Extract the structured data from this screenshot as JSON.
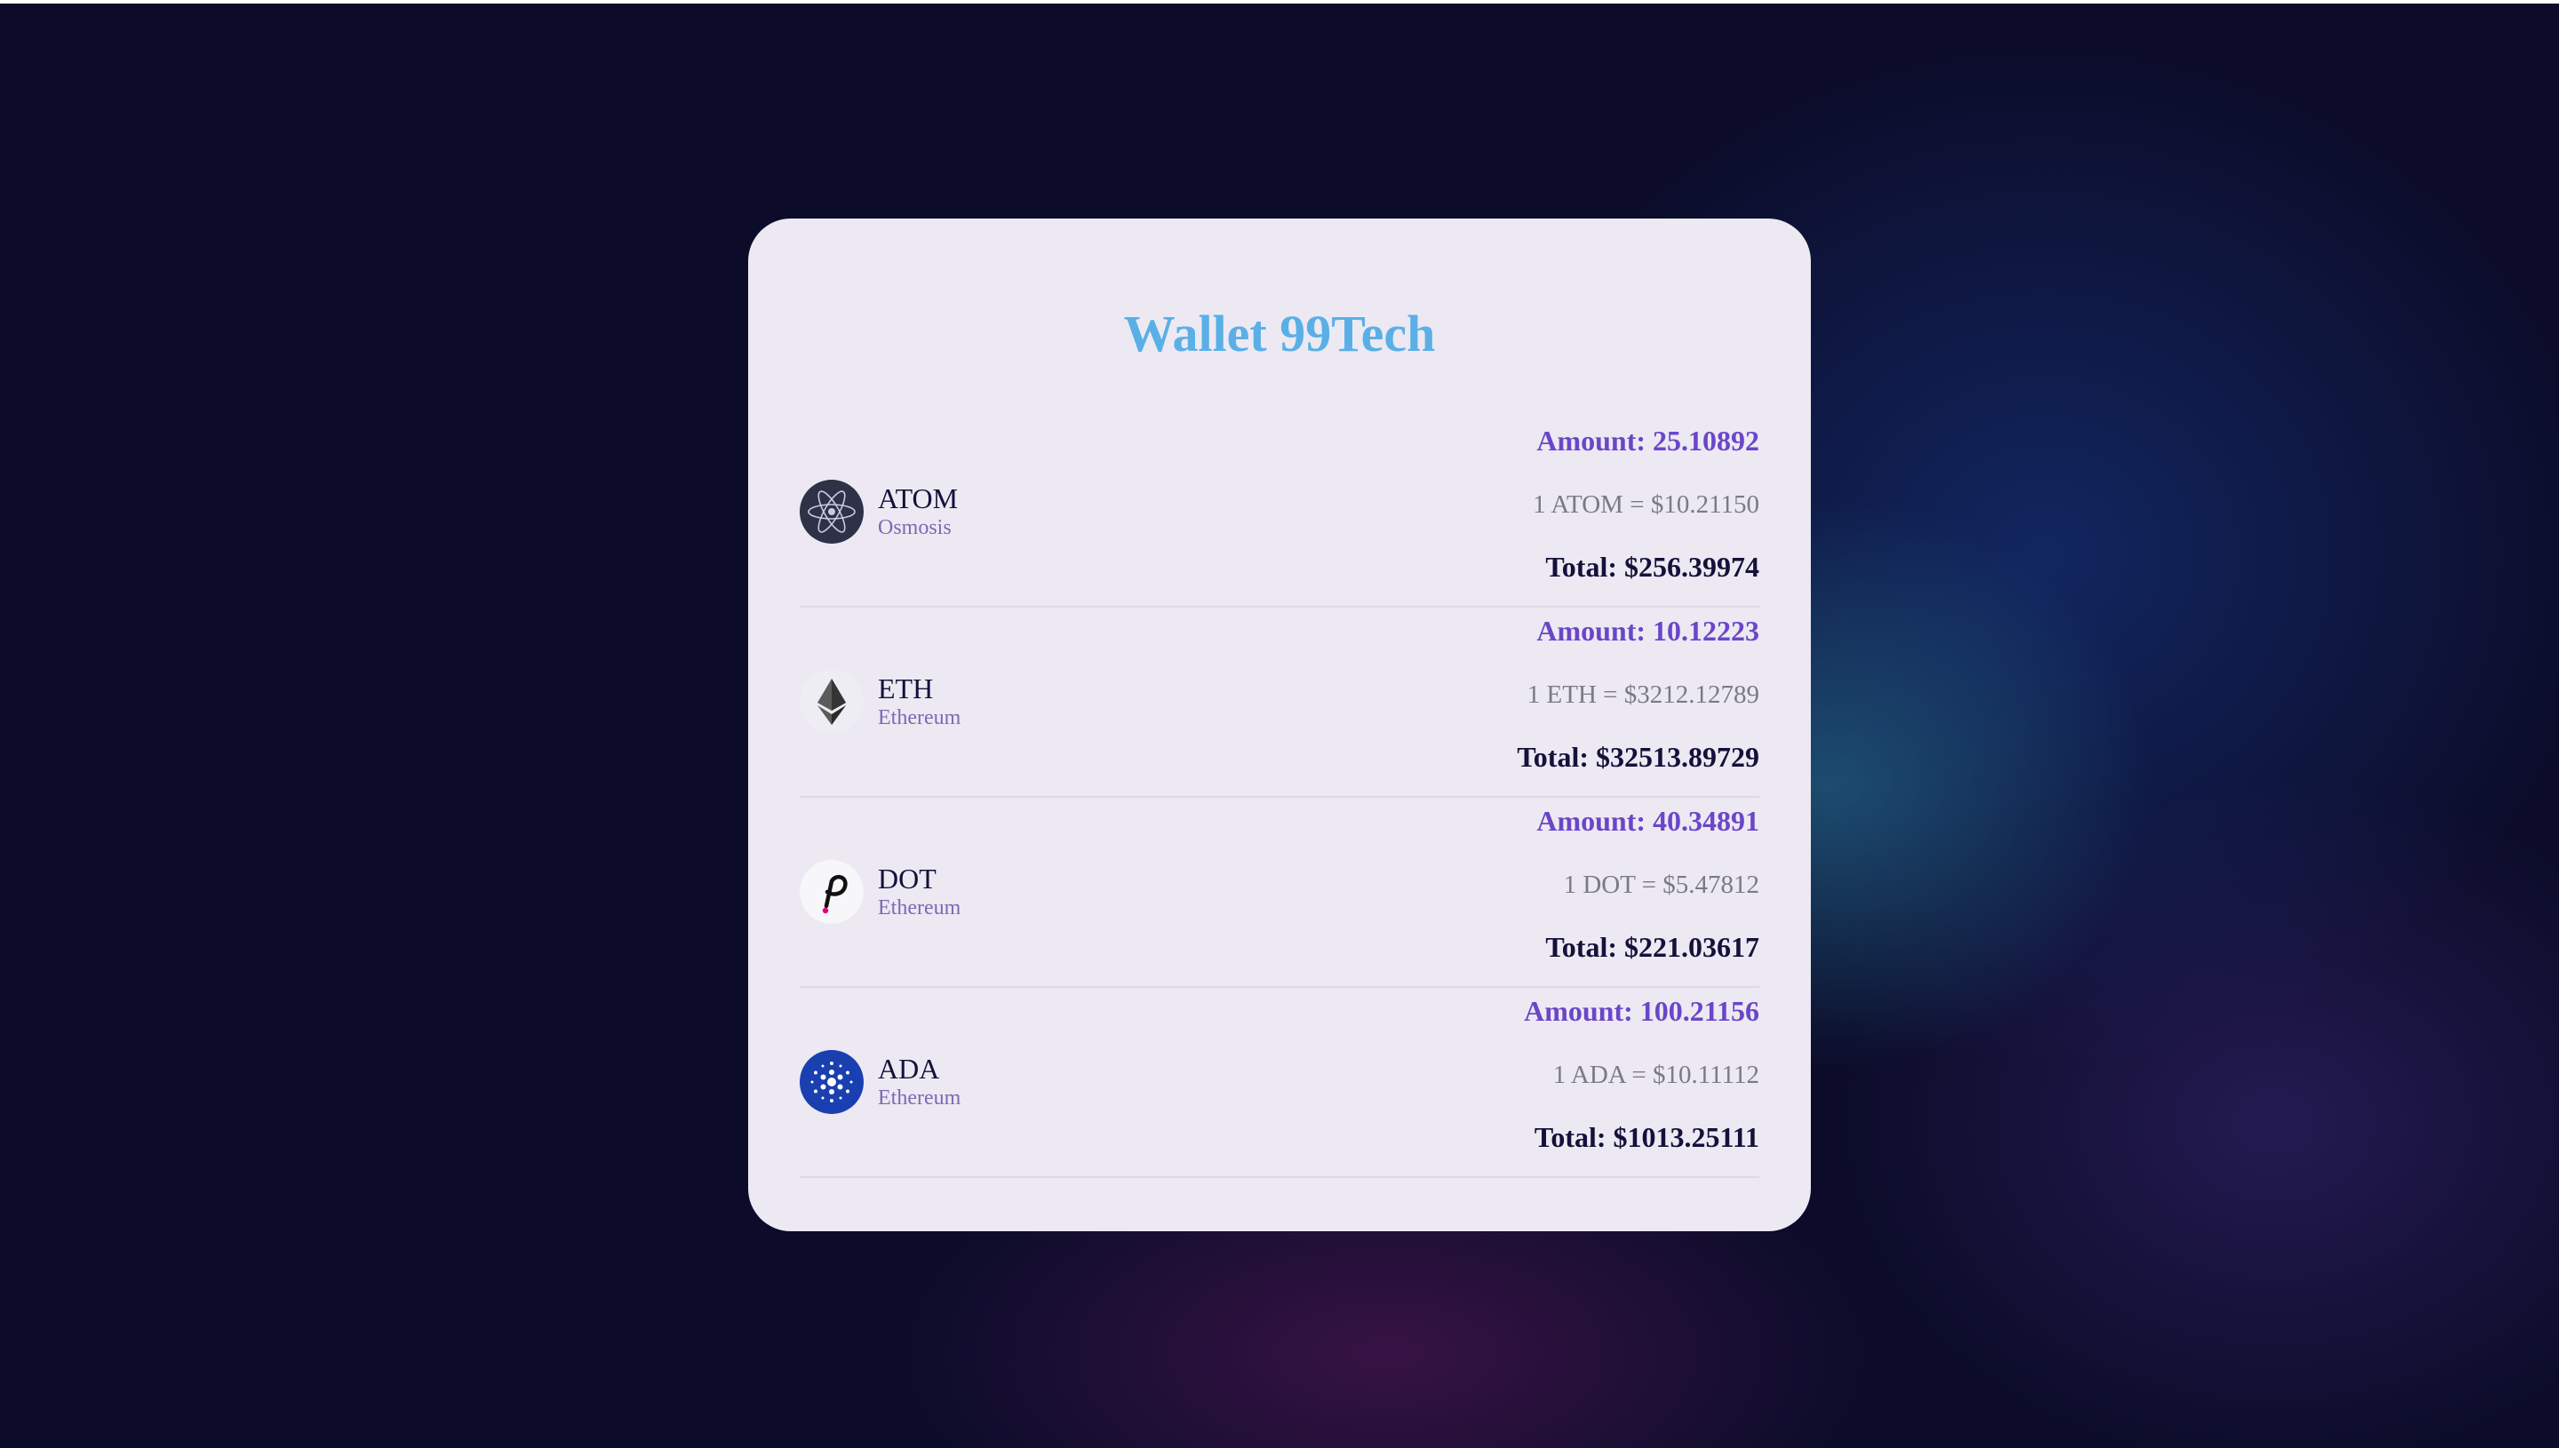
{
  "app": {
    "title": "Wallet 99Tech"
  },
  "colors": {
    "title": "#5ab0e6",
    "amount": "#6b46c8",
    "rate": "#7a7a86",
    "total": "#14113a",
    "card": "#ece9f3",
    "network": "#7a6ab3"
  },
  "balances": [
    {
      "symbol": "ATOM",
      "network": "Osmosis",
      "icon": "atom-icon",
      "amount": "Amount: 25.10892",
      "rate": "1 ATOM = $10.21150",
      "total": "Total: $256.39974"
    },
    {
      "symbol": "ETH",
      "network": "Ethereum",
      "icon": "eth-icon",
      "amount": "Amount: 10.12223",
      "rate": "1 ETH = $3212.12789",
      "total": "Total: $32513.89729"
    },
    {
      "symbol": "DOT",
      "network": "Ethereum",
      "icon": "dot-icon",
      "amount": "Amount: 40.34891",
      "rate": "1 DOT = $5.47812",
      "total": "Total: $221.03617"
    },
    {
      "symbol": "ADA",
      "network": "Ethereum",
      "icon": "ada-icon",
      "amount": "Amount: 100.21156",
      "rate": "1 ADA = $10.11112",
      "total": "Total: $1013.25111"
    }
  ]
}
